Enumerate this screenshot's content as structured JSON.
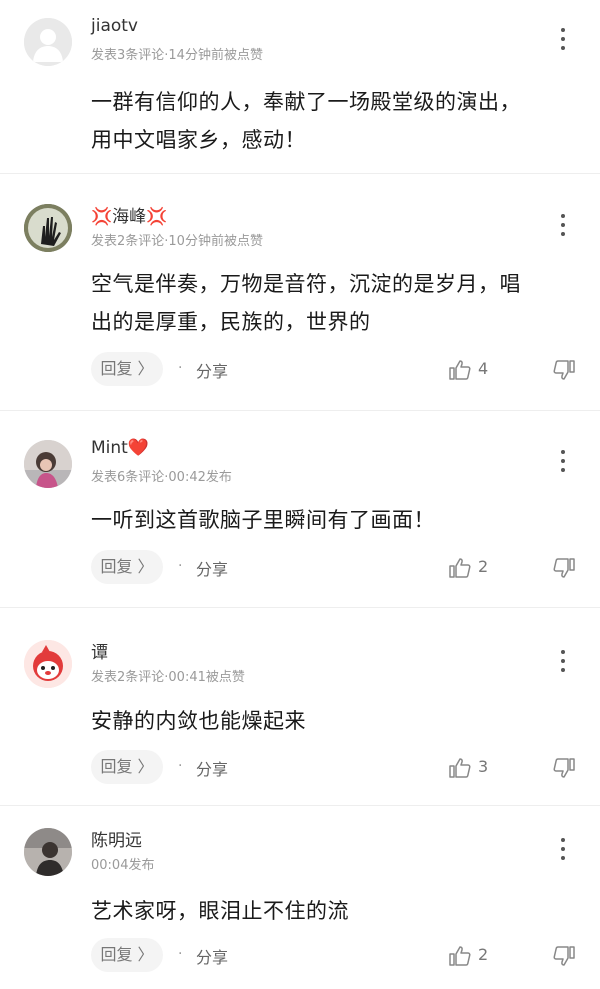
{
  "comments": [
    {
      "username": "jiaotv",
      "meta": "发表3条评论·14分钟前被点赞",
      "lines": [
        "一群有信仰的人，奉献了一场殿堂级的演出，",
        "用中文唱家乡，感动！"
      ],
      "show_actions": false
    },
    {
      "username": "💢海峰💢",
      "meta": "发表2条评论·10分钟前被点赞",
      "lines": [
        "空气是伴奏，万物是音符，沉淀的是岁月，唱",
        "出的是厚重，民族的，世界的"
      ],
      "reply_label": "回复 〉",
      "share_label": "分享",
      "likes": "4",
      "show_actions": true
    },
    {
      "username": "Mint❤️",
      "meta": "发表6条评论·00:42发布",
      "lines": [
        "一听到这首歌脑子里瞬间有了画面！"
      ],
      "reply_label": "回复 〉",
      "share_label": "分享",
      "likes": "2",
      "show_actions": true
    },
    {
      "username": "谭",
      "meta": "发表2条评论·00:41被点赞",
      "lines": [
        "安静的内敛也能燥起来"
      ],
      "reply_label": "回复 〉",
      "share_label": "分享",
      "likes": "3",
      "show_actions": true
    },
    {
      "username": "陈明远",
      "meta": "00:04发布",
      "lines": [
        "艺术家呀，眼泪止不住的流"
      ],
      "reply_label": "回复 〉",
      "share_label": "分享",
      "likes": "2",
      "show_actions": true
    }
  ],
  "icons": {
    "more": "more-vertical-icon",
    "like": "thumbs-up-icon",
    "dislike": "thumbs-down-icon"
  }
}
